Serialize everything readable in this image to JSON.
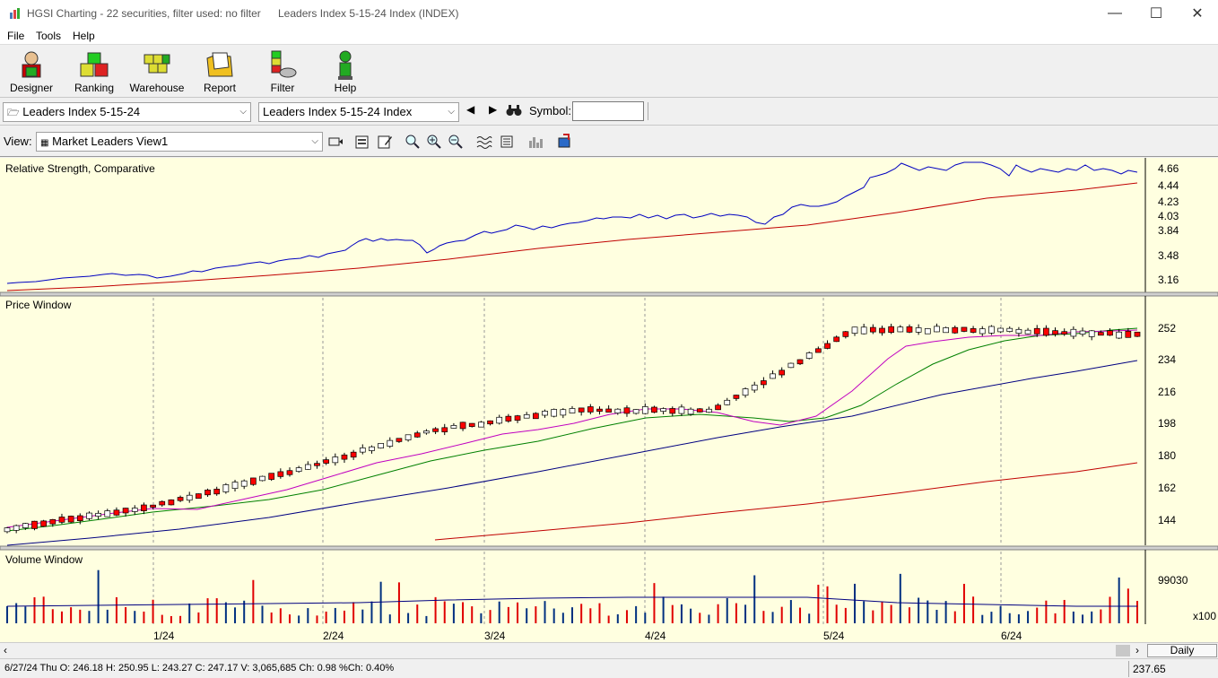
{
  "window": {
    "title": "HGSI Charting - 22 securities, filter used: no filter",
    "subtitle": "Leaders Index 5-15-24 Index (INDEX)",
    "minimize": "—",
    "maximize": "☐",
    "close": "✕"
  },
  "menu": [
    "File",
    "Tools",
    "Help"
  ],
  "toolbar": [
    {
      "label": "Designer",
      "icon": "designer-icon"
    },
    {
      "label": "Ranking",
      "icon": "ranking-icon"
    },
    {
      "label": "Warehouse",
      "icon": "warehouse-icon"
    },
    {
      "label": "Report",
      "icon": "report-icon"
    },
    {
      "label": "Filter",
      "icon": "filter-icon"
    },
    {
      "label": "Help",
      "icon": "help-icon"
    }
  ],
  "selectors": {
    "group": "Leaders Index 5-15-24",
    "security": "Leaders Index 5-15-24 Index",
    "symbol_label": "Symbol:",
    "symbol_value": ""
  },
  "view": {
    "label": "View:",
    "value": "Market Leaders View1"
  },
  "panels": {
    "rs_title": "Relative Strength, Comparative",
    "price_title": "Price Window",
    "volume_title": "Volume Window"
  },
  "axes": {
    "rs_ticks": [
      "4.66",
      "4.44",
      "4.23",
      "4.03",
      "3.84",
      "3.48",
      "3.16"
    ],
    "price_ticks": [
      "252",
      "234",
      "216",
      "198",
      "180",
      "162",
      "144"
    ],
    "volume_ticks": [
      "99030"
    ],
    "volume_multiplier": "x100",
    "date_ticks": [
      "1/24",
      "2/24",
      "3/24",
      "4/24",
      "5/24",
      "6/24"
    ]
  },
  "colors": {
    "background": "#ffffe0",
    "rs_line": "#0000c0",
    "rs_ma": "#c00000",
    "up_candle": "#ffffff",
    "down_candle": "#ff0000",
    "ma_short": "#c000c0",
    "ma_mid": "#008000",
    "ma_long": "#000080",
    "ma_200": "#c00000"
  },
  "chart_data": {
    "type": "line",
    "price_series": [
      {
        "x": "12/2023",
        "y": 141
      },
      {
        "x": "1/24",
        "y": 153
      },
      {
        "x": "2/24",
        "y": 172
      },
      {
        "x": "3/24",
        "y": 195
      },
      {
        "x": "4/24",
        "y": 206
      },
      {
        "x": "5/24",
        "y": 206
      },
      {
        "x": "5/24 mid",
        "y": 250
      },
      {
        "x": "6/24",
        "y": 250
      },
      {
        "x": "6/27/24",
        "y": 247.17
      }
    ],
    "ylim": [
      136,
      262
    ]
  },
  "status": {
    "quote": "6/27/24 Thu O: 246.18 H: 250.95 L: 243.27 C: 247.17 V: 3,065,685 Ch: 0.98 %Ch: 0.40%",
    "last_value": "237.65",
    "period": "Daily"
  }
}
